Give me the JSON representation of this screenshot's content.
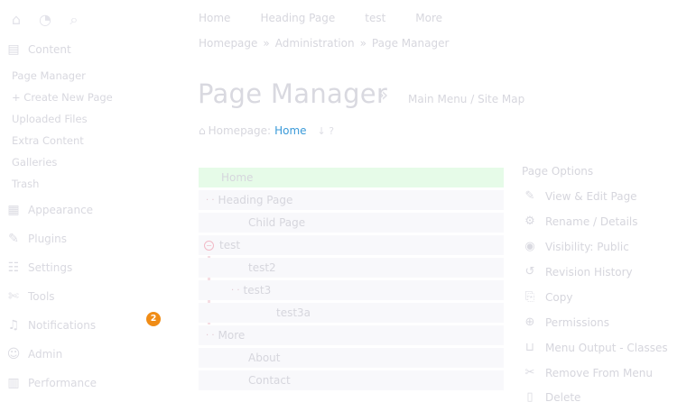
{
  "sidebar": {
    "top_icons": [
      {
        "name": "home-icon",
        "glyph": "⌂"
      },
      {
        "name": "dashboard-icon",
        "glyph": "◔"
      },
      {
        "name": "search-icon",
        "glyph": "⌕"
      }
    ],
    "content": {
      "label": "Content",
      "icon": "file-icon",
      "glyph": "▤"
    },
    "sub_items": [
      "Page Manager",
      "+ Create New Page",
      "Uploaded Files",
      "Extra Content",
      "Galleries",
      "Trash"
    ],
    "items": [
      {
        "label": "Appearance",
        "icon": "grid-icon",
        "glyph": "▦"
      },
      {
        "label": "Plugins",
        "icon": "plugin-icon",
        "glyph": "✎"
      },
      {
        "label": "Settings",
        "icon": "settings-icon",
        "glyph": "☷"
      },
      {
        "label": "Tools",
        "icon": "wrench-icon",
        "glyph": "✄"
      },
      {
        "label": "Notifications",
        "icon": "bell-icon",
        "glyph": "♫"
      },
      {
        "label": "Admin",
        "icon": "user-icon",
        "glyph": "☺"
      },
      {
        "label": "Performance",
        "icon": "chart-icon",
        "glyph": "▥"
      }
    ],
    "notification_count": "2"
  },
  "topnav": [
    "Home",
    "Heading Page",
    "test",
    "More"
  ],
  "breadcrumb": [
    "Homepage",
    "Administration",
    "Page Manager"
  ],
  "breadcrumb_sep": "»",
  "page": {
    "title": "Page Manager",
    "title_arrow": "»",
    "menu_path": "Main Menu / Site Map",
    "homepage_label": "Homepage:",
    "homepage_link": "Home",
    "homepage_extra": "↓ ?"
  },
  "tree": [
    {
      "label": "Home",
      "level": 0,
      "active": true,
      "handle": false,
      "minus": false
    },
    {
      "label": "Heading Page",
      "level": 0,
      "active": false,
      "handle": true,
      "minus": false
    },
    {
      "label": "Child Page",
      "level": 1,
      "active": false,
      "handle": false,
      "minus": false
    },
    {
      "label": "test",
      "level": 0,
      "active": false,
      "handle": false,
      "minus": true
    },
    {
      "label": "test2",
      "level": 1,
      "active": false,
      "handle": false,
      "minus": false
    },
    {
      "label": "test3",
      "level": 1,
      "active": false,
      "handle": true,
      "minus": false
    },
    {
      "label": "test3a",
      "level": 2,
      "active": false,
      "handle": false,
      "minus": false
    },
    {
      "label": "More",
      "level": 0,
      "active": false,
      "handle": true,
      "minus": false
    },
    {
      "label": "About",
      "level": 1,
      "active": false,
      "handle": false,
      "minus": false
    },
    {
      "label": "Contact",
      "level": 1,
      "active": false,
      "handle": false,
      "minus": false
    }
  ],
  "options": {
    "title": "Page Options",
    "items": [
      {
        "label": "View & Edit Page",
        "icon": "pencil-icon",
        "glyph": "✎"
      },
      {
        "label": "Rename / Details",
        "icon": "cogs-icon",
        "glyph": "⚙"
      },
      {
        "label": "Visibility: Public",
        "icon": "eye-icon",
        "glyph": "◉"
      },
      {
        "label": "Revision History",
        "icon": "history-icon",
        "glyph": "↺"
      },
      {
        "label": "Copy",
        "icon": "copy-icon",
        "glyph": "⎘"
      },
      {
        "label": "Permissions",
        "icon": "lock-icon",
        "glyph": "⊕"
      },
      {
        "label": "Menu Output - Classes",
        "icon": "code-icon",
        "glyph": "⊔"
      },
      {
        "label": "Remove From Menu",
        "icon": "scissors-icon",
        "glyph": "✂"
      },
      {
        "label": "Delete",
        "icon": "trash-icon",
        "glyph": "▯"
      }
    ]
  },
  "colors": {
    "link": "#3a9ad9",
    "badge": "#f08c16",
    "active_row": "#e6fbe8",
    "tree_row": "#f8f8fb"
  }
}
